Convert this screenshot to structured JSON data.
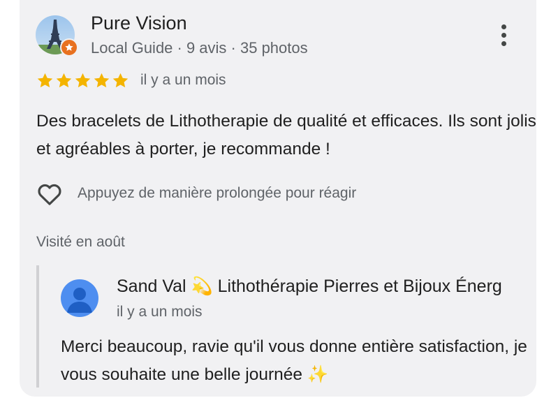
{
  "review": {
    "reviewer_name": "Pure Vision",
    "reviewer_meta": "Local Guide · 9 avis · 35 photos",
    "rating": 5,
    "rating_max": 5,
    "time": "il y a un mois",
    "text": "Des bracelets de Lithotherapie de qualité et efficaces. Ils sont jolis et agréables à porter, je recommande !",
    "react_hint": "Appuyez de manière prolongée pour réagir",
    "visited": "Visité en août"
  },
  "reply": {
    "owner_name": "Sand Val 💫 Lithothérapie Pierres et Bijoux Énerg",
    "time": "il y a un mois",
    "text": "Merci beaucoup, ravie qu'il vous donne entière satisfaction, je vous souhaite une belle journée ✨"
  },
  "icons": {
    "avatar": "eiffel-tower-photo",
    "badge": "local-guide-star-icon",
    "menu": "more-vert-icon",
    "star": "star-icon",
    "heart": "heart-outline-icon",
    "owner_avatar": "default-person-icon"
  },
  "colors": {
    "star": "#f4b400",
    "badge": "#e8711f",
    "card_background": "#f1f1f3",
    "owner_avatar": "#4e8ef0"
  }
}
